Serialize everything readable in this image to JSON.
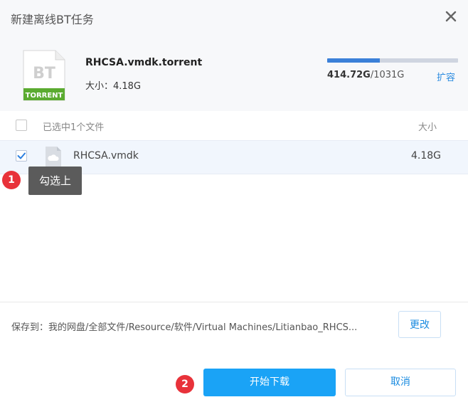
{
  "dialog": {
    "title": "新建离线BT任务",
    "close_icon": "close-icon"
  },
  "torrent": {
    "icon_text_top": "BT",
    "icon_text_bottom": "TORRENT",
    "filename": "RHCSA.vmdk.torrent",
    "size_label": "大小：4.18G"
  },
  "quota": {
    "used": "414.72G",
    "total": "/1031G",
    "used_fraction": 0.402,
    "expand_label": "扩容",
    "bar_color": "#3b80d8"
  },
  "list": {
    "header_label": "已选中1个文件",
    "header_size": "大小",
    "files": [
      {
        "name": "RHCSA.vmdk",
        "size": "4.18G",
        "checked": true
      }
    ]
  },
  "annotations": {
    "badge1": "1",
    "tooltip": "勾选上",
    "badge2": "2"
  },
  "save": {
    "path": "保存到：我的网盘/全部文件/Resource/软件/Virtual Machines/Litianbao_RHCS...",
    "change_label": "更改"
  },
  "actions": {
    "start_label": "开始下载",
    "cancel_label": "取消"
  },
  "colors": {
    "primary": "#1aa3f6",
    "badge_red": "#e8323a",
    "bt_green": "#5bab30"
  }
}
